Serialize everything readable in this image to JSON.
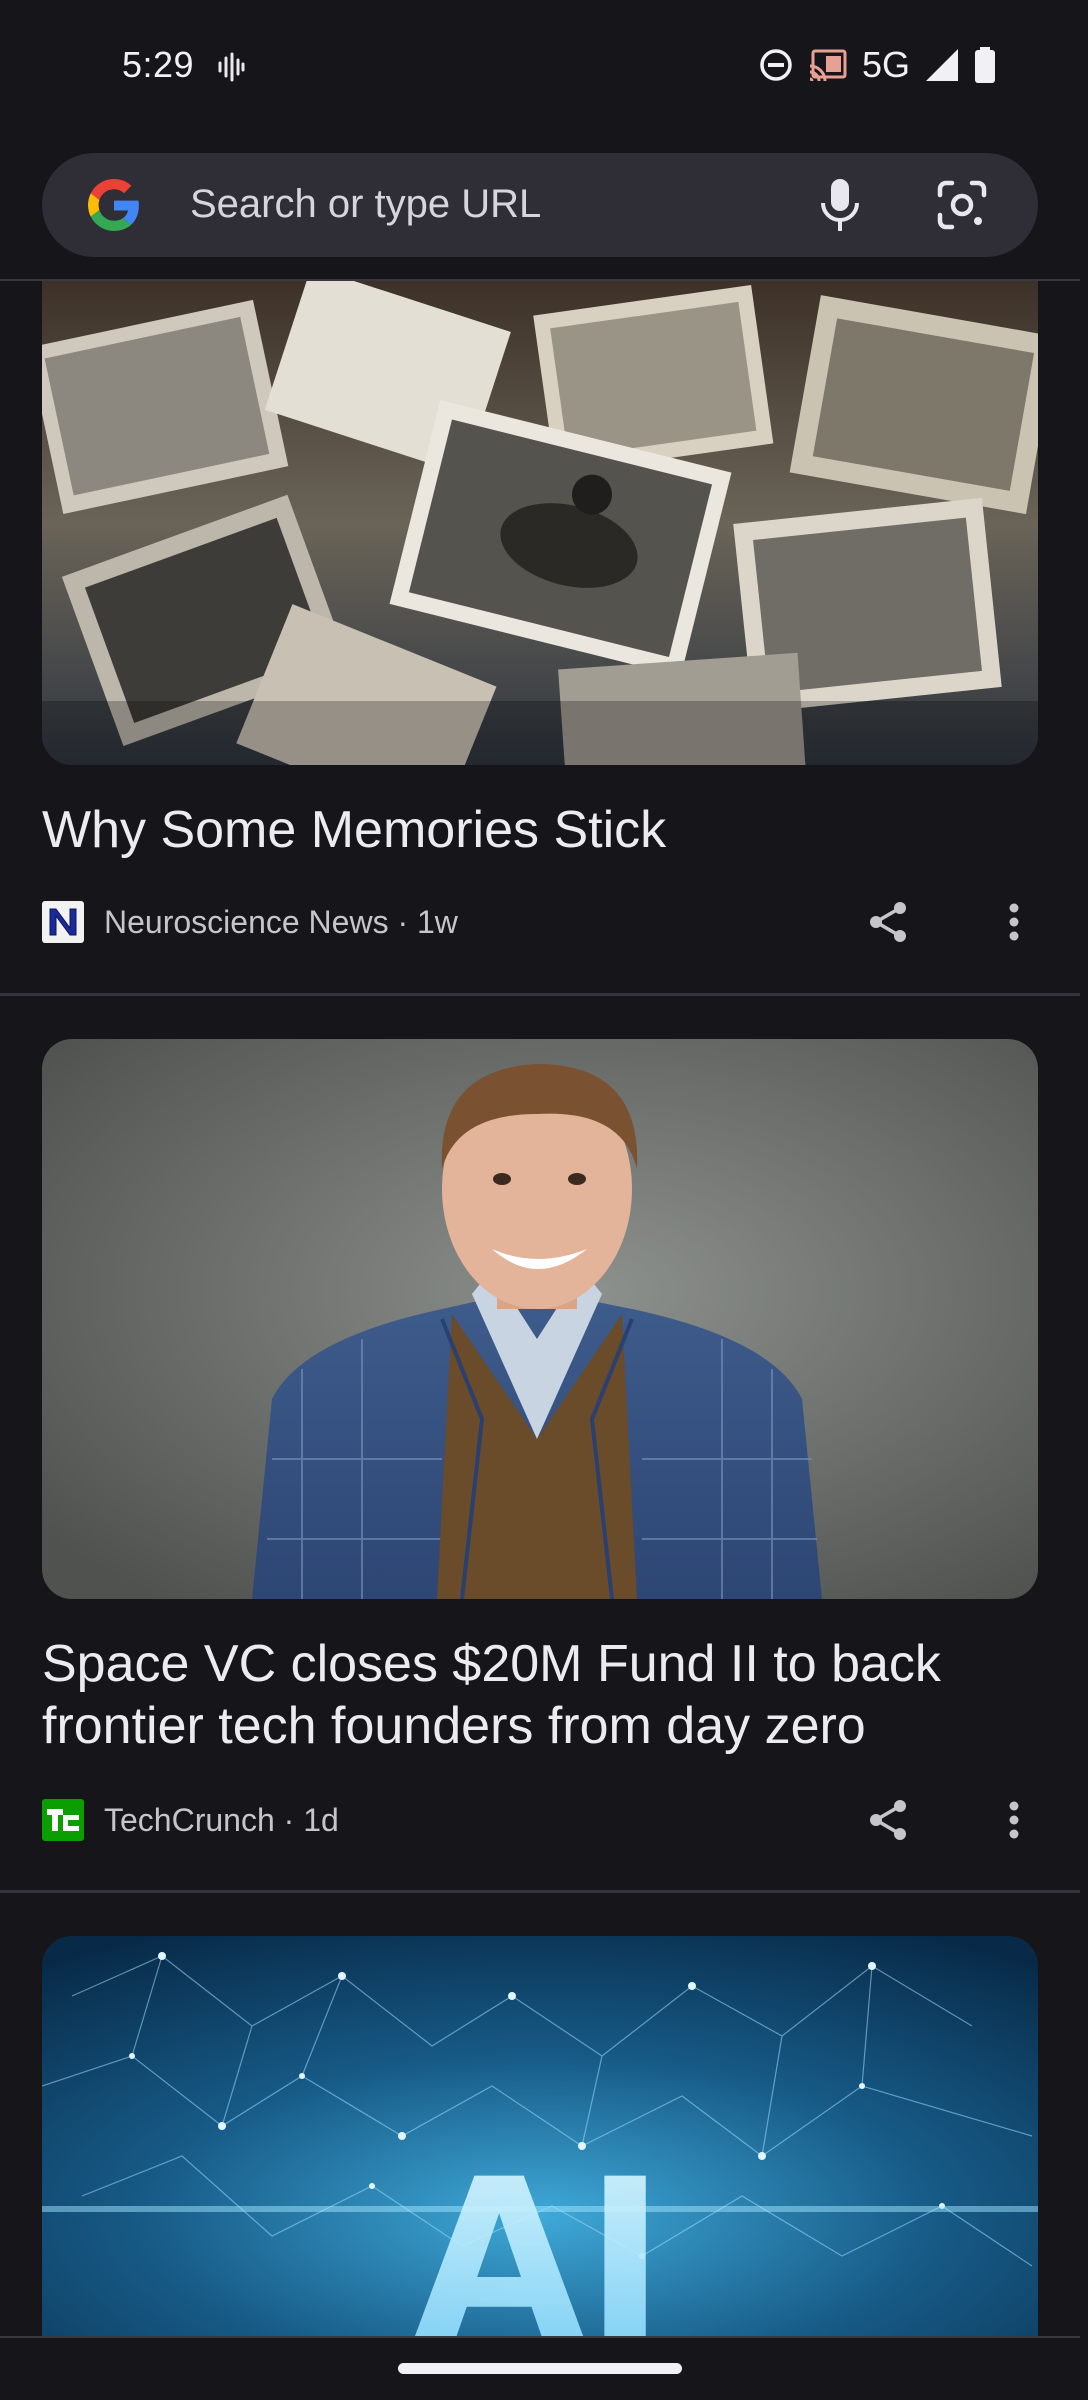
{
  "status_bar": {
    "time": "5:29",
    "network": "5G",
    "icons": [
      "voice-wave-icon",
      "do-not-disturb-icon",
      "cast-icon",
      "signal-icon",
      "battery-icon"
    ]
  },
  "omnibox": {
    "placeholder": "Search or type URL",
    "icons": [
      "google-logo-icon",
      "mic-icon",
      "google-lens-icon"
    ]
  },
  "feed": {
    "articles": [
      {
        "title": "Why Some Memories Stick",
        "source": "Neuroscience News",
        "age": "1w",
        "byline": "Neuroscience News · 1w",
        "favicon": "neuroscience-news-favicon",
        "image": "scattered-old-photographs"
      },
      {
        "title": "Space VC closes $20M Fund II to back frontier tech founders from day zero",
        "source": "TechCrunch",
        "age": "1d",
        "byline": "TechCrunch · 1d",
        "favicon": "techcrunch-favicon",
        "image": "smiling-man-in-blue-plaid-blazer"
      },
      {
        "image": "ai-digital-network-illustration",
        "image_text": "AI"
      }
    ]
  },
  "colors": {
    "background": "#16151a",
    "omnibox": "#2f2d36",
    "text_primary": "#ececf0",
    "text_secondary": "#c7c5cc",
    "techcrunch_green": "#0a9e01"
  }
}
